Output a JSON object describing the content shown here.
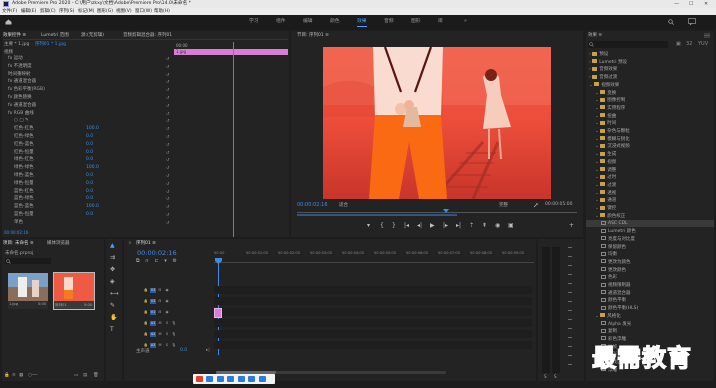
{
  "window": {
    "title": "Adobe Premiere Pro 2020 - C:\\用户\\zkxy\\文档\\Adobe\\Premiere Pro\\14.0\\未命名 *",
    "controls": [
      "—",
      "☐",
      "✕"
    ]
  },
  "menu": [
    "文件(F)",
    "编辑(E)",
    "剪辑(C)",
    "序列(S)",
    "标记(M)",
    "图形(G)",
    "视图(V)",
    "窗口(W)",
    "帮助(H)"
  ],
  "workspaces": {
    "items": [
      "学习",
      "组件",
      "编辑",
      "颜色",
      "效果",
      "音频",
      "图形",
      "库"
    ],
    "active": "效果"
  },
  "effect_controls": {
    "tabs": [
      "效果控件 ≡",
      "Lumetri 范围",
      "源:(无剪辑)",
      "音频剪辑混合器: 序列01"
    ],
    "master": "主要 * 1.jpg",
    "clip": "序列01 * 1.jpg",
    "ruler_time": "00:00",
    "clip_label": "1.jpg",
    "section": "视频",
    "rows": [
      {
        "label": "fx 运动",
        "value": ""
      },
      {
        "label": "fx 不透明度",
        "value": ""
      },
      {
        "label": "时间重映射",
        "value": ""
      },
      {
        "label": "fx 通道混合器",
        "value": ""
      },
      {
        "label": "fx 色彩平衡(RGB)",
        "value": ""
      },
      {
        "label": "fx 颜色替换",
        "value": ""
      },
      {
        "label": "fx 通道混合器",
        "value": ""
      },
      {
        "label": "fx RGB 曲线",
        "value": ""
      },
      {
        "label": "○ □ ✎",
        "value": ""
      },
      {
        "label": "红色-红色",
        "value": "100.0"
      },
      {
        "label": "红色-绿色",
        "value": "0.0"
      },
      {
        "label": "红色-蓝色",
        "value": "0.0"
      },
      {
        "label": "红色-恒量",
        "value": "0.0"
      },
      {
        "label": "绿色-红色",
        "value": "0.0"
      },
      {
        "label": "绿色-绿色",
        "value": "100.0"
      },
      {
        "label": "绿色-蓝色",
        "value": "0.0"
      },
      {
        "label": "绿色-恒量",
        "value": "0.0"
      },
      {
        "label": "蓝色-红色",
        "value": "0.0"
      },
      {
        "label": "蓝色-绿色",
        "value": "0.0"
      },
      {
        "label": "蓝色-蓝色",
        "value": "100.0"
      },
      {
        "label": "蓝色-恒量",
        "value": "0.0"
      },
      {
        "label": "单色",
        "value": ""
      }
    ],
    "footer_time": "00:00:02:16"
  },
  "program": {
    "tab": "节目: 序列01 ≡",
    "timecode": "00:00:02:16",
    "fit": "适合",
    "quality": "完整",
    "duration": "00:00:05:00"
  },
  "project": {
    "tabs": [
      "项目: 未命名 ≡",
      "媒体浏览器"
    ],
    "filename": "未命名.prproj",
    "items": [
      {
        "name": "1.jpg",
        "meta": "5:00"
      },
      {
        "name": "序列01",
        "meta": "5:00"
      }
    ]
  },
  "timeline": {
    "tab": "序列01 ≡",
    "timecode": "00:00:02:16",
    "ruler": [
      "00:00",
      "00:00:01:00",
      "00:00:02:00",
      "00:00:03:00",
      "00:00:04:00",
      "00:00:05:00",
      "00:00:06:00",
      "00:00:07:00",
      "00:00:08:00",
      "00:00:09:00"
    ],
    "tracks": [
      {
        "name": "V3",
        "kind": "video"
      },
      {
        "name": "V2",
        "kind": "video"
      },
      {
        "name": "V1",
        "kind": "video"
      },
      {
        "name": "A1",
        "kind": "audio"
      },
      {
        "name": "A2",
        "kind": "audio"
      },
      {
        "name": "A3",
        "kind": "audio"
      }
    ],
    "master": {
      "label": "主声道",
      "value": "0.0"
    }
  },
  "effects": {
    "tab": "效果 ≡",
    "items": [
      {
        "label": "预设",
        "depth": 0,
        "kind": "folder"
      },
      {
        "label": "Lumetri 预设",
        "depth": 0,
        "kind": "folder"
      },
      {
        "label": "音频效果",
        "depth": 0,
        "kind": "folder"
      },
      {
        "label": "音频过渡",
        "depth": 0,
        "kind": "folder"
      },
      {
        "label": "视频效果",
        "depth": 0,
        "kind": "folder"
      },
      {
        "label": "变换",
        "depth": 1,
        "kind": "folder"
      },
      {
        "label": "图像控制",
        "depth": 1,
        "kind": "folder"
      },
      {
        "label": "实用程序",
        "depth": 1,
        "kind": "folder"
      },
      {
        "label": "扭曲",
        "depth": 1,
        "kind": "folder"
      },
      {
        "label": "时间",
        "depth": 1,
        "kind": "folder"
      },
      {
        "label": "杂色与颗粒",
        "depth": 1,
        "kind": "folder"
      },
      {
        "label": "模糊与锐化",
        "depth": 1,
        "kind": "folder"
      },
      {
        "label": "沉浸式视频",
        "depth": 1,
        "kind": "folder"
      },
      {
        "label": "生成",
        "depth": 1,
        "kind": "folder"
      },
      {
        "label": "视频",
        "depth": 1,
        "kind": "folder"
      },
      {
        "label": "调整",
        "depth": 1,
        "kind": "folder"
      },
      {
        "label": "过时",
        "depth": 1,
        "kind": "folder"
      },
      {
        "label": "过渡",
        "depth": 1,
        "kind": "folder"
      },
      {
        "label": "透视",
        "depth": 1,
        "kind": "folder"
      },
      {
        "label": "通道",
        "depth": 1,
        "kind": "folder"
      },
      {
        "label": "键控",
        "depth": 1,
        "kind": "folder"
      },
      {
        "label": "颜色校正",
        "depth": 1,
        "kind": "folder"
      },
      {
        "label": "ASC CDL",
        "depth": 2,
        "kind": "fx",
        "selected": true
      },
      {
        "label": "Lumetri 颜色",
        "depth": 2,
        "kind": "fx"
      },
      {
        "label": "亮度与对比度",
        "depth": 2,
        "kind": "fx"
      },
      {
        "label": "保留颜色",
        "depth": 2,
        "kind": "fx"
      },
      {
        "label": "均衡",
        "depth": 2,
        "kind": "fx"
      },
      {
        "label": "更改为颜色",
        "depth": 2,
        "kind": "fx"
      },
      {
        "label": "更改颜色",
        "depth": 2,
        "kind": "fx"
      },
      {
        "label": "色彩",
        "depth": 2,
        "kind": "fx"
      },
      {
        "label": "视频限制器",
        "depth": 2,
        "kind": "fx"
      },
      {
        "label": "通道混合器",
        "depth": 2,
        "kind": "fx"
      },
      {
        "label": "颜色平衡",
        "depth": 2,
        "kind": "fx"
      },
      {
        "label": "颜色平衡(HLS)",
        "depth": 2,
        "kind": "fx"
      },
      {
        "label": "风格化",
        "depth": 1,
        "kind": "folder"
      },
      {
        "label": "Alpha 发光",
        "depth": 2,
        "kind": "fx"
      },
      {
        "label": "复制",
        "depth": 2,
        "kind": "fx"
      },
      {
        "label": "彩色浮雕",
        "depth": 2,
        "kind": "fx"
      },
      {
        "label": "抽帧",
        "depth": 2,
        "kind": "fx"
      },
      {
        "label": "曝光",
        "depth": 2,
        "kind": "fx"
      },
      {
        "label": "查找边缘",
        "depth": 2,
        "kind": "fx"
      },
      {
        "label": "浮雕",
        "depth": 2,
        "kind": "fx"
      }
    ]
  },
  "watermark": "最需教育",
  "colors": {
    "accent": "#3c8ce7",
    "clip": "#d77fd5",
    "frame_bg": "#e64a3a"
  }
}
